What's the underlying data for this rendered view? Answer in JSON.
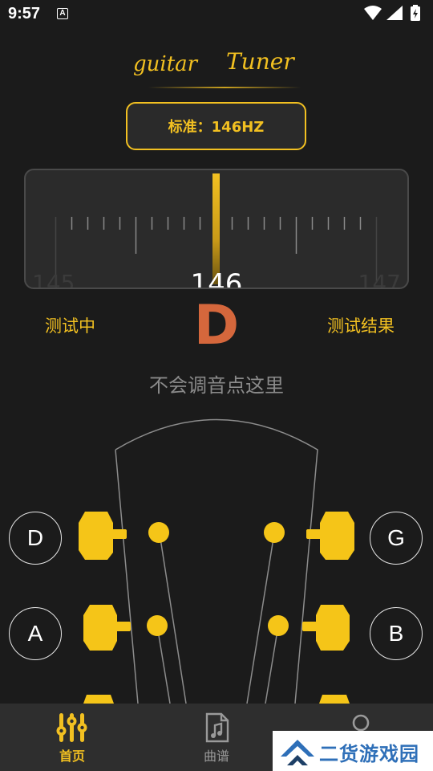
{
  "status_bar": {
    "time": "9:57",
    "notification_letter": "A"
  },
  "logo": {
    "word1": "guitar",
    "word2": "Tuner"
  },
  "standard": {
    "label": "标准：146HZ"
  },
  "meter": {
    "left_value": "145",
    "center_value": "146",
    "right_value": "147",
    "needle_offset": 0
  },
  "status": {
    "testing": "测试中",
    "result": "测试结果"
  },
  "current_note": "D",
  "hint": "不会调音点这里",
  "strings": {
    "left_top": "D",
    "left_mid": "A",
    "right_top": "G",
    "right_mid": "B"
  },
  "tabs": [
    {
      "label": "首页",
      "icon": "tuner-sliders-icon",
      "active": true
    },
    {
      "label": "曲谱",
      "icon": "music-sheet-icon",
      "active": false
    },
    {
      "label": "",
      "icon": "profile-icon",
      "active": false
    }
  ],
  "watermark": {
    "text": "二货游戏园"
  },
  "colors": {
    "accent": "#f2c021",
    "note": "#d5673c",
    "background": "#1b1b1b",
    "tab_bar": "#2e2e2e"
  }
}
